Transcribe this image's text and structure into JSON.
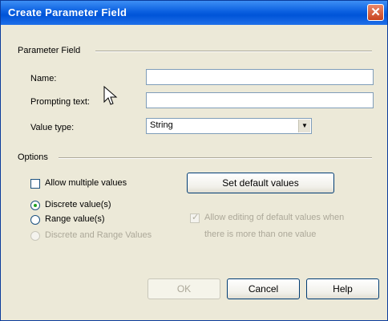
{
  "window": {
    "title": "Create Parameter Field",
    "close_glyph": "✕"
  },
  "parameter_field": {
    "group_label": "Parameter Field",
    "name_label": "Name:",
    "name_value": "",
    "prompting_label": "Prompting text:",
    "prompting_value": "",
    "value_type_label": "Value type:",
    "value_type_value": "String"
  },
  "options": {
    "group_label": "Options",
    "allow_multiple_label": "Allow multiple values",
    "allow_multiple_checked": false,
    "discrete_label": "Discrete value(s)",
    "discrete_selected": true,
    "range_label": "Range value(s)",
    "range_selected": false,
    "discrete_and_range_label": "Discrete and Range Values",
    "set_default_label": "Set default values",
    "allow_editing_label_line1": "Allow editing of default values when",
    "allow_editing_label_line2": "there is more than one value",
    "allow_editing_checked": true
  },
  "buttons": {
    "ok": "OK",
    "cancel": "Cancel",
    "help": "Help"
  },
  "icons": {
    "dropdown": "chevron-down-icon",
    "cursor": "mouse-pointer-icon",
    "close": "close-icon"
  }
}
